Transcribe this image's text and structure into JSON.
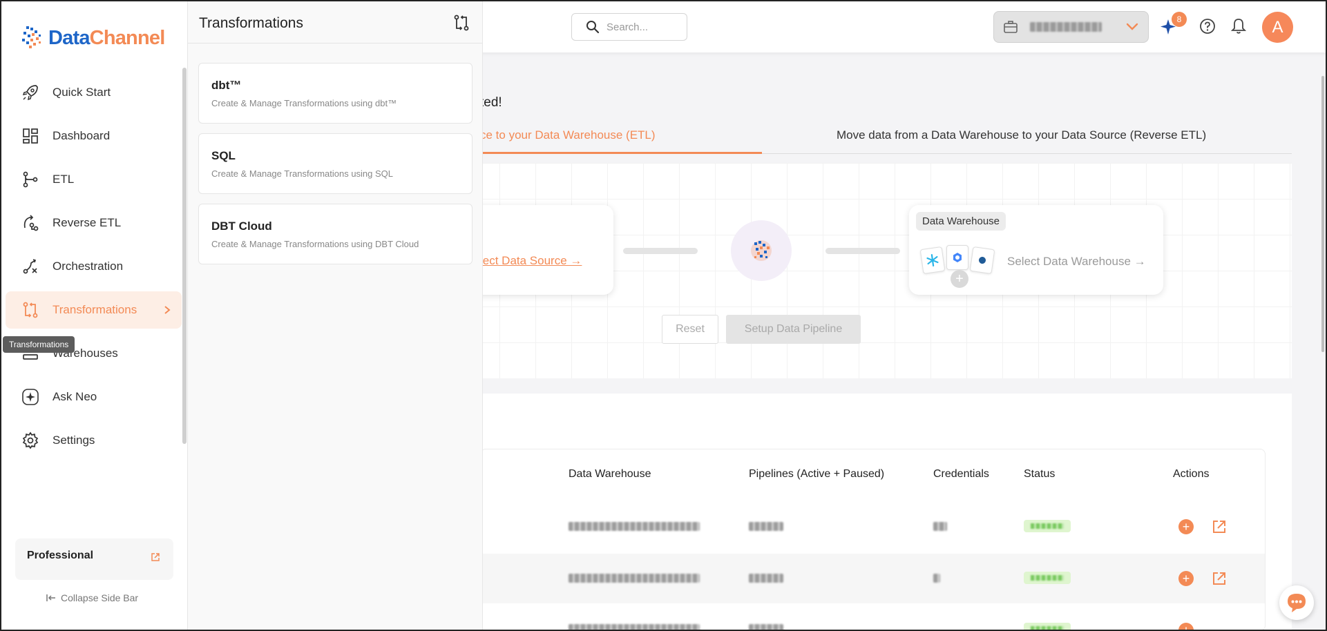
{
  "topbar": {
    "search_placeholder": "Search...",
    "notifications_count": "8",
    "avatar_initial": "A"
  },
  "brand": {
    "part1": "Data",
    "part2": "Channel",
    "color_primary": "#1e66c8",
    "color_accent": "#f38a55"
  },
  "sidebar": {
    "items": [
      {
        "label": "Quick Start",
        "icon": "rocket-icon"
      },
      {
        "label": "Dashboard",
        "icon": "dashboard-grid-icon"
      },
      {
        "label": "ETL",
        "icon": "etl-flow-icon"
      },
      {
        "label": "Reverse ETL",
        "icon": "reverse-etl-icon"
      },
      {
        "label": "Orchestration",
        "icon": "orchestration-icon"
      },
      {
        "label": "Transformations",
        "icon": "transformations-icon",
        "active": true
      },
      {
        "label": "Warehouses",
        "icon": "warehouse-icon"
      },
      {
        "label": "Ask Neo",
        "icon": "sparkle-icon"
      },
      {
        "label": "Settings",
        "icon": "gear-icon"
      }
    ],
    "tooltip": "Transformations",
    "plan": "Professional",
    "collapse_label": "Collapse Side Bar"
  },
  "flyout": {
    "title": "Transformations",
    "cards": [
      {
        "title": "dbt™",
        "subtitle": "Create & Manage Transformations using dbt™"
      },
      {
        "title": "SQL",
        "subtitle": "Create & Manage Transformations using SQL"
      },
      {
        "title": "DBT Cloud",
        "subtitle": "Create & Manage Transformations using DBT Cloud"
      }
    ]
  },
  "main": {
    "partial_heading": "ted!",
    "tabs": {
      "active": "ce to your Data Warehouse (ETL)",
      "inactive": "Move data from a Data Warehouse to your Data Source (Reverse ETL)"
    },
    "pipeline": {
      "source_link": "lect Data Source →",
      "dw_tag": "Data Warehouse",
      "dw_select": "Select Data Warehouse →",
      "reset_label": "Reset",
      "setup_label": "Setup Data Pipeline"
    },
    "table": {
      "headers": [
        "Data Warehouse",
        "Pipelines (Active + Paused)",
        "Credentials",
        "Status",
        "Actions"
      ]
    }
  }
}
